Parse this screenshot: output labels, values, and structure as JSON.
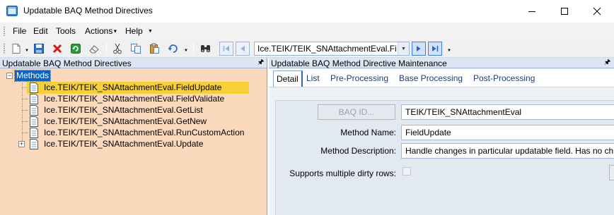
{
  "window": {
    "title": "Updatable BAQ Method Directives",
    "minimize_glyph": "—",
    "maximize_glyph": "☐",
    "close_glyph": "✕"
  },
  "menu": {
    "items": [
      {
        "label": "File"
      },
      {
        "label": "Edit"
      },
      {
        "label": "Tools"
      },
      {
        "label": "Actions"
      },
      {
        "label": "Help"
      }
    ]
  },
  "toolbar": {
    "icons": [
      "new-icon",
      "save-icon",
      "delete-icon",
      "refresh-icon",
      "clear-icon",
      "cut-icon",
      "copy-icon",
      "paste-icon",
      "undo-icon",
      "search-icon",
      "first-record-icon",
      "previous-record-icon",
      "next-record-icon",
      "last-record-icon"
    ],
    "navigation_value": "Ice.TEIK/TEIK_SNAttachmentEval.Fi"
  },
  "left_pane": {
    "header": "Updatable BAQ Method Directives",
    "tree": {
      "root_label": "Methods",
      "root_expander": "−",
      "items": [
        {
          "label": "Ice.TEIK/TEIK_SNAttachmentEval.FieldUpdate",
          "selected": true,
          "expander": ""
        },
        {
          "label": "Ice.TEIK/TEIK_SNAttachmentEval.FieldValidate",
          "selected": false,
          "expander": ""
        },
        {
          "label": "Ice.TEIK/TEIK_SNAttachmentEval.GetList",
          "selected": false,
          "expander": ""
        },
        {
          "label": "Ice.TEIK/TEIK_SNAttachmentEval.GetNew",
          "selected": false,
          "expander": ""
        },
        {
          "label": "Ice.TEIK/TEIK_SNAttachmentEval.RunCustomAction",
          "selected": false,
          "expander": ""
        },
        {
          "label": "Ice.TEIK/TEIK_SNAttachmentEval.Update",
          "selected": false,
          "expander": "+"
        }
      ]
    }
  },
  "right_pane": {
    "header": "Updatable BAQ Method Directive Maintenance",
    "tabs": [
      {
        "label": "Detail",
        "active": true
      },
      {
        "label": "List",
        "active": false
      },
      {
        "label": "Pre-Processing",
        "active": false
      },
      {
        "label": "Base Processing",
        "active": false
      },
      {
        "label": "Post-Processing",
        "active": false
      }
    ],
    "form": {
      "baq_id_button": "BAQ ID...",
      "baq_id_value": "TEIK/TEIK_SNAttachmentEval",
      "method_name_label": "Method Name:",
      "method_name_value": "FieldUpdate",
      "method_description_label": "Method Description:",
      "method_description_value": "Handle changes in particular updatable field. Has no ch",
      "multiple_dirty_rows_label": "Supports multiple dirty rows:",
      "multiple_dirty_rows_checked": false
    }
  },
  "colors": {
    "left_pane_bg": "#fbd9bd",
    "tree_root_selection": "#0a64c8",
    "tree_item_selection": "#f5d137",
    "pane_header_bg": "#dbe6f5"
  }
}
